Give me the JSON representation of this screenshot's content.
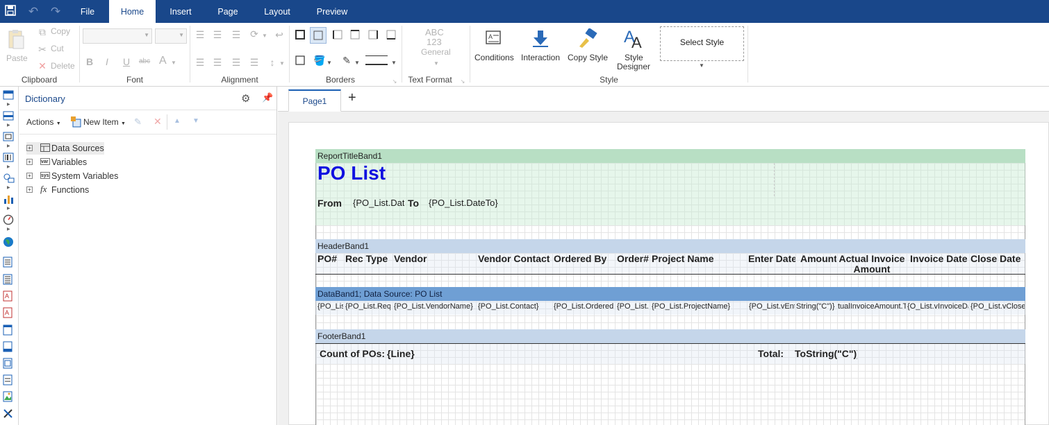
{
  "menu": {
    "tabs": [
      "File",
      "Home",
      "Insert",
      "Page",
      "Layout",
      "Preview"
    ],
    "active_tab": "Home"
  },
  "ribbon": {
    "clipboard": {
      "paste": "Paste",
      "copy": "Copy",
      "cut": "Cut",
      "delete": "Delete",
      "label": "Clipboard"
    },
    "font": {
      "bold": "B",
      "italic": "I",
      "underline": "U",
      "strike": "abc",
      "color": "A",
      "label": "Font"
    },
    "alignment": {
      "label": "Alignment"
    },
    "borders": {
      "label": "Borders"
    },
    "text_format": {
      "line1": "ABC",
      "line2": "123",
      "value": "General",
      "label": "Text Format"
    },
    "style": {
      "conditions": "Conditions",
      "interaction": "Interaction",
      "copy_style": "Copy Style",
      "style_designer_1": "Style",
      "style_designer_2": "Designer",
      "select_style": "Select Style",
      "label": "Style"
    }
  },
  "dictionary": {
    "title": "Dictionary",
    "actions": "Actions",
    "new_item": "New Item",
    "tree": [
      {
        "label": "Data Sources",
        "icon": "table-icon"
      },
      {
        "label": "Variables",
        "icon": "variables-icon"
      },
      {
        "label": "System Variables",
        "icon": "system-variables-icon"
      },
      {
        "label": "Functions",
        "icon": "function-icon"
      }
    ]
  },
  "pages": {
    "tab": "Page1",
    "add": "+"
  },
  "report": {
    "title_band": "ReportTitleBand1",
    "title": "PO List",
    "from_label": "From",
    "from_value": "{PO_List.Dat",
    "to_label": "To",
    "to_value": "{PO_List.DateTo}",
    "header_band": "HeaderBand1",
    "columns": [
      "PO#",
      "Rec Type",
      "Vendor",
      "Vendor Contact",
      "Ordered By",
      "Order#",
      "Project Name",
      "Enter Date",
      "Amount",
      "Actual Invoice Amount",
      "Invoice Date",
      "Close Date"
    ],
    "data_band": "DataBand1; Data Source: PO List",
    "data_fields": [
      "{PO_Lis",
      "{PO_List.Req",
      "{PO_List.VendorName}",
      "{PO_List.Contact}",
      "{PO_List.Orderedl",
      "{PO_List.",
      "{PO_List.ProjectName}",
      "{PO_List.vEnt",
      "String(\"C\")}",
      "tualInvoiceAmount.To",
      "{O_List.vInvoiceDat",
      "{PO_List.vClose"
    ],
    "footer_band": "FooterBand1",
    "count_label": "Count of POs:",
    "count_value": "{Line}",
    "total_label": "Total:",
    "total_value": "ToString(\"C\")}"
  },
  "colors": {
    "menubar": "#19478a",
    "title_band": "#b8dfc4",
    "header_band": "#c5d6ea",
    "data_band": "#6f9fd4",
    "footer_band": "#c5d6ea",
    "title_text": "#1010e0"
  }
}
